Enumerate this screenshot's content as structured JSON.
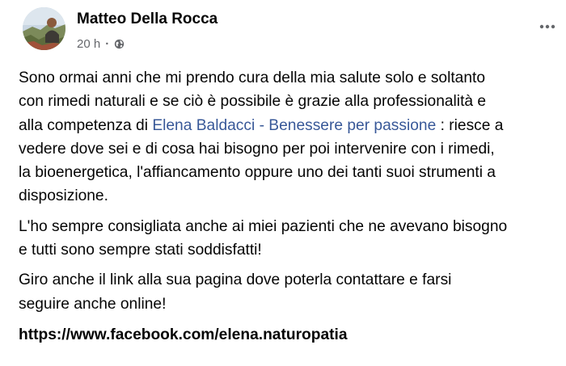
{
  "post": {
    "author": "Matteo Della Rocca",
    "time": "20 h",
    "separator": "·",
    "privacy_icon": "globe-icon",
    "more_icon": "more-horizontal-icon",
    "paragraphs": {
      "p1": {
        "line1": "Sono ormai anni che mi prendo cura della mia salute solo e soltanto",
        "line2": "con rimedi naturali e se ciò è possibile è grazie alla professionalità e",
        "line3_before": "alla competenza di ",
        "mention": "Elena Baldacci - Benessere per passione",
        "line3_after": " : riesce a",
        "line4": "vedere dove sei e di cosa hai bisogno per poi intervenire con i rimedi,",
        "line5": "la bioenergetica, l'affiancamento oppure uno dei tanti suoi strumenti a",
        "line6": "disposizione."
      },
      "p2": {
        "line1": "L'ho sempre consigliata anche ai miei pazienti che ne avevano bisogno",
        "line2": "e tutti sono sempre stati soddisfatti!"
      },
      "p3": {
        "line1": "Giro anche il link alla sua pagina dove poterla contattare e farsi",
        "line2": "seguire anche online!"
      }
    },
    "link": "https://www.facebook.com/elena.naturopatia"
  },
  "colors": {
    "mention": "#385898",
    "meta": "#65676b",
    "text": "#050505"
  }
}
